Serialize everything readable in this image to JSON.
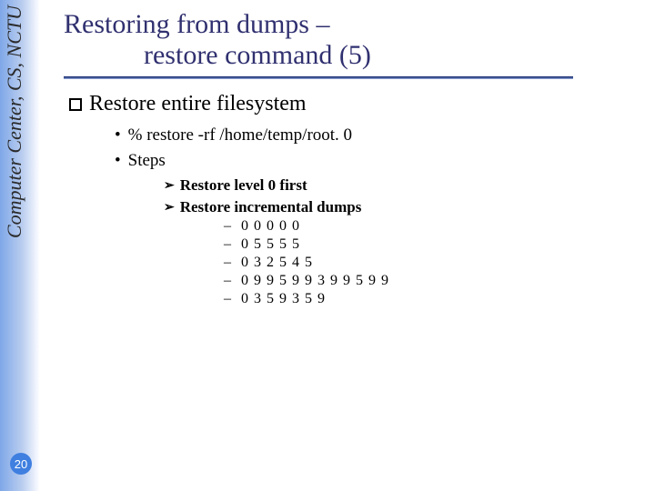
{
  "sidebar": {
    "label": "Computer Center, CS, NCTU"
  },
  "page_number": "20",
  "title": {
    "line1": "Restoring from dumps –",
    "line2": "restore command (5)"
  },
  "section": {
    "heading": "Restore entire filesystem"
  },
  "bullets": {
    "cmd": "% restore -rf  /home/temp/root. 0",
    "steps_label": "Steps",
    "step1": "Restore level 0 first",
    "step2": "Restore incremental dumps",
    "seq": {
      "a": "0 0 0 0 0",
      "b": "0 5 5 5 5",
      "c": "0 3 2 5 4 5",
      "d": "0 9 9 5 9 9 3 9 9 5 9 9",
      "e": "0 3 5 9 3 5 9"
    }
  }
}
